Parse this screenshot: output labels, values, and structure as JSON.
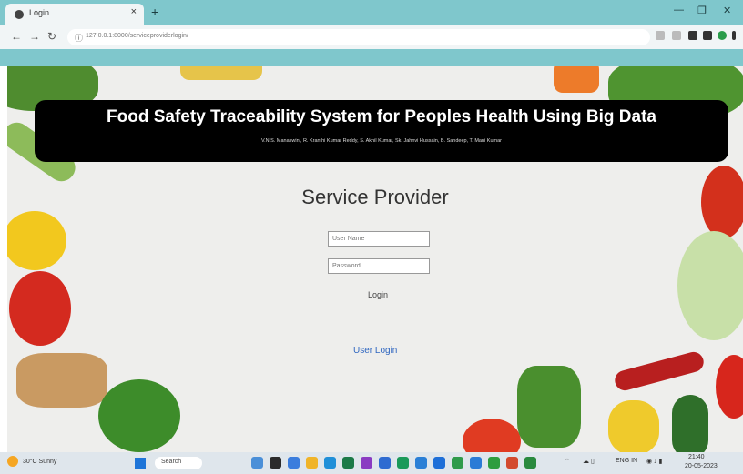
{
  "browser": {
    "tab_title": "Login",
    "url": "127.0.0.1:8000/serviceproviderlogin/",
    "window_controls": [
      "—",
      "❐",
      "✕"
    ]
  },
  "page": {
    "header_title": "Food Safety Traceability System for Peoples Health Using Big Data",
    "authors": "V.N.S. Manaswini, R. Kranthi Kumar Reddy, S. Akhil Kumar, Sk. Jahnvi Hussain, B. Sandeep, T. Mani Kumar",
    "heading": "Service Provider",
    "username_placeholder": "User Name",
    "password_placeholder": "Password",
    "login_label": "Login",
    "user_login_link": "User Login"
  },
  "taskbar": {
    "weather_temp": "30°C",
    "weather_desc": "Sunny",
    "search_label": "Search",
    "lang": "ENG IN",
    "time": "21:40",
    "date": "20-05-2023"
  }
}
